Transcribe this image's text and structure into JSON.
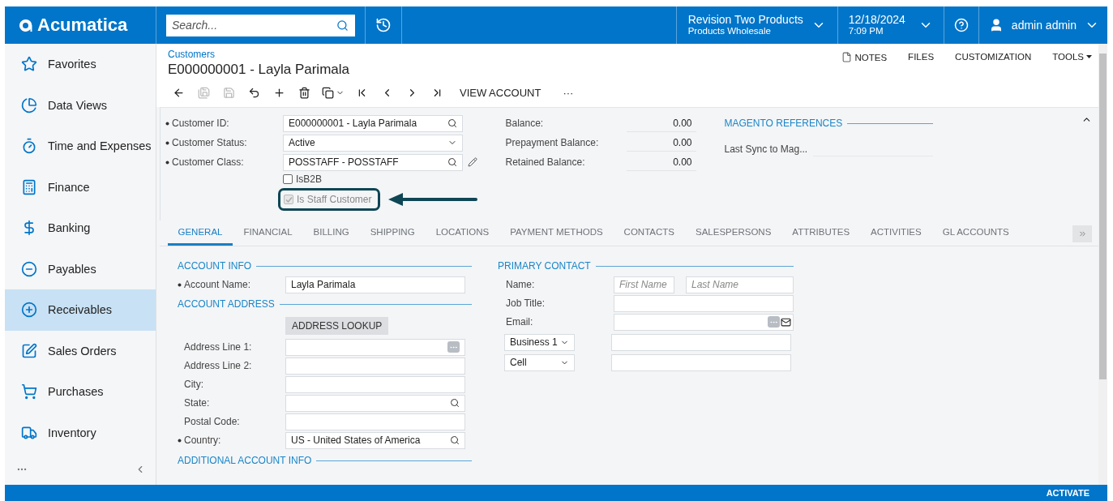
{
  "brand": {
    "name": "Acumatica"
  },
  "search": {
    "placeholder": "Search..."
  },
  "company": {
    "name": "Revision Two Products",
    "branch": "Products Wholesale"
  },
  "date": {
    "date": "12/18/2024",
    "time": "7:09 PM"
  },
  "user": {
    "name": "admin admin"
  },
  "sidebar": {
    "items": [
      {
        "label": "Favorites",
        "selected": false
      },
      {
        "label": "Data Views",
        "selected": false
      },
      {
        "label": "Time and Expenses",
        "selected": false
      },
      {
        "label": "Finance",
        "selected": false
      },
      {
        "label": "Banking",
        "selected": false
      },
      {
        "label": "Payables",
        "selected": false
      },
      {
        "label": "Receivables",
        "selected": true
      },
      {
        "label": "Sales Orders",
        "selected": false
      },
      {
        "label": "Purchases",
        "selected": false
      },
      {
        "label": "Inventory",
        "selected": false
      }
    ]
  },
  "breadcrumb": "Customers",
  "title": "E000000001 - Layla Parimala",
  "top_links": [
    {
      "label": "NOTES",
      "kind": "note"
    },
    {
      "label": "FILES",
      "kind": "plain"
    },
    {
      "label": "CUSTOMIZATION",
      "kind": "plain"
    },
    {
      "label": "TOOLS",
      "kind": "menu"
    }
  ],
  "toolbar": [
    {
      "kind": "back",
      "disabled": false
    },
    {
      "kind": "saveclose",
      "disabled": true
    },
    {
      "kind": "save",
      "disabled": true
    },
    {
      "kind": "undo",
      "disabled": false
    },
    {
      "kind": "add",
      "disabled": false
    },
    {
      "kind": "delete",
      "disabled": false
    },
    {
      "kind": "copy",
      "disabled": false
    },
    {
      "kind": "first",
      "disabled": false
    },
    {
      "kind": "prev",
      "disabled": false
    },
    {
      "kind": "next",
      "disabled": false
    },
    {
      "kind": "last",
      "disabled": false
    },
    {
      "kind": "text",
      "label": "VIEW ACCOUNT",
      "disabled": false
    },
    {
      "kind": "text",
      "label": "···",
      "disabled": false
    }
  ],
  "summary": {
    "fields": [
      {
        "label": "Customer ID:",
        "required": true,
        "value": "E000000001 - Layla Parimala",
        "kind": "lookup",
        "editable": false
      },
      {
        "label": "Customer Status:",
        "required": true,
        "value": "Active",
        "kind": "select",
        "editable": false
      },
      {
        "label": "Customer Class:",
        "required": true,
        "value": "POSSTAFF - POSSTAFF",
        "kind": "lookup",
        "editable": true
      }
    ],
    "checkboxes": [
      {
        "label": "IsB2B",
        "checked": false,
        "disabled": false,
        "highlighted": false
      },
      {
        "label": "Is Staff Customer",
        "checked": true,
        "disabled": true,
        "highlighted": true
      }
    ],
    "balances": [
      {
        "label": "Balance:",
        "value": "0.00"
      },
      {
        "label": "Prepayment Balance:",
        "value": "0.00"
      },
      {
        "label": "Retained Balance:",
        "value": "0.00"
      }
    ],
    "magento": {
      "title": "MAGENTO REFERENCES",
      "fields": [
        {
          "label": "Last Sync to Mag..."
        }
      ]
    }
  },
  "tabs": [
    {
      "label": "GENERAL",
      "selected": true
    },
    {
      "label": "FINANCIAL",
      "selected": false
    },
    {
      "label": "BILLING",
      "selected": false
    },
    {
      "label": "SHIPPING",
      "selected": false
    },
    {
      "label": "LOCATIONS",
      "selected": false
    },
    {
      "label": "PAYMENT METHODS",
      "selected": false
    },
    {
      "label": "CONTACTS",
      "selected": false
    },
    {
      "label": "SALESPERSONS",
      "selected": false
    },
    {
      "label": "ATTRIBUTES",
      "selected": false
    },
    {
      "label": "ACTIVITIES",
      "selected": false
    },
    {
      "label": "GL ACCOUNTS",
      "selected": false
    }
  ],
  "account_info": {
    "title": "ACCOUNT INFO",
    "fields": [
      {
        "label": "Account Name:",
        "required": true,
        "value": "Layla Parimala"
      }
    ]
  },
  "account_address": {
    "title": "ACCOUNT ADDRESS",
    "button": "ADDRESS LOOKUP",
    "fields": [
      {
        "label": "Address Line 1:",
        "required": false,
        "kind": "more"
      },
      {
        "label": "Address Line 2:",
        "required": false
      },
      {
        "label": "City:",
        "required": false
      },
      {
        "label": "State:",
        "required": false,
        "kind": "lookup"
      },
      {
        "label": "Postal Code:",
        "required": false
      },
      {
        "label": "Country:",
        "required": true,
        "value": "US - United States of America",
        "kind": "lookup"
      }
    ]
  },
  "additional_info": {
    "title": "ADDITIONAL ACCOUNT INFO"
  },
  "primary_contact": {
    "title": "PRIMARY CONTACT",
    "name_label": "Name:",
    "first_placeholder": "First Name",
    "last_placeholder": "Last Name",
    "job_title_label": "Job Title:",
    "email_label": "Email:",
    "phones": [
      {
        "type": "Business 1"
      },
      {
        "type": "Cell"
      }
    ]
  },
  "footer": {
    "action": "ACTIVATE"
  }
}
